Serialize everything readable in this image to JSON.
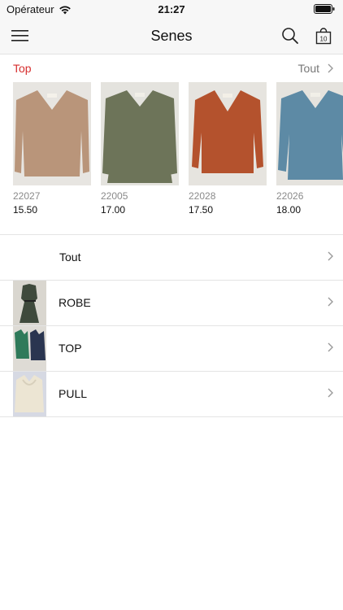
{
  "status_bar": {
    "carrier": "Opérateur",
    "time": "21:27"
  },
  "nav": {
    "title": "Senes",
    "cart_count": "10",
    "icons": [
      "menu-icon",
      "search-icon",
      "shopping-bag-icon"
    ]
  },
  "section": {
    "label": "Top",
    "see_all": "Tout",
    "accent_color": "#d62e2e"
  },
  "products": [
    {
      "code": "22027",
      "price": "15.50",
      "color": "#b9957a"
    },
    {
      "code": "22005",
      "price": "17.00",
      "color": "#6d7459"
    },
    {
      "code": "22028",
      "price": "17.50",
      "color": "#b4522d"
    },
    {
      "code": "22026",
      "price": "18.00",
      "color": "#5d8aa5"
    }
  ],
  "categories": [
    {
      "label": "Tout",
      "has_thumb": false
    },
    {
      "label": "ROBE",
      "has_thumb": true
    },
    {
      "label": "TOP",
      "has_thumb": true
    },
    {
      "label": "PULL",
      "has_thumb": true
    }
  ]
}
